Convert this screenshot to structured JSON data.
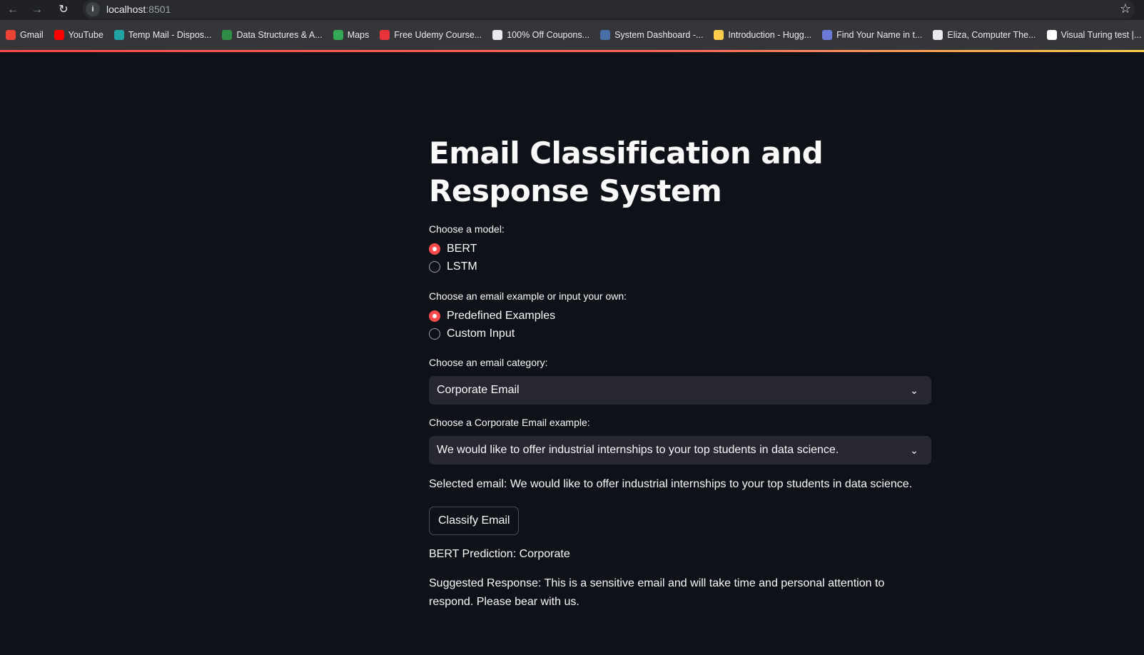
{
  "browser": {
    "url_host": "localhost",
    "url_port": ":8501",
    "bookmarks": [
      {
        "label": "Gmail",
        "icon": "gmail-icon",
        "color": "#ea4335"
      },
      {
        "label": "YouTube",
        "icon": "youtube-icon",
        "color": "#ff0000"
      },
      {
        "label": "Temp Mail - Dispos...",
        "icon": "temp-mail-icon",
        "color": "#20a4a4"
      },
      {
        "label": "Data Structures & A...",
        "icon": "gfg-icon",
        "color": "#2f8d46"
      },
      {
        "label": "Maps",
        "icon": "maps-icon",
        "color": "#34a853"
      },
      {
        "label": "Free Udemy Course...",
        "icon": "udemy-icon",
        "color": "#e8333a"
      },
      {
        "label": "100% Off Coupons...",
        "icon": "globe-icon",
        "color": "#e8eaed"
      },
      {
        "label": "System Dashboard -...",
        "icon": "dashboard-icon",
        "color": "#4a6fa5"
      },
      {
        "label": "Introduction - Hugg...",
        "icon": "huggingface-icon",
        "color": "#ffcc4d"
      },
      {
        "label": "Find Your Name in t...",
        "icon": "document-icon",
        "color": "#6b7bd6"
      },
      {
        "label": "Eliza, Computer The...",
        "icon": "globe-icon",
        "color": "#e8eaed"
      },
      {
        "label": "Visual Turing test |...",
        "icon": "ns-icon",
        "color": "#ffffff"
      }
    ]
  },
  "app": {
    "title": "Email Classification and Response System",
    "model_label": "Choose a model:",
    "model_options": [
      "BERT",
      "LSTM"
    ],
    "model_selected": "BERT",
    "source_label": "Choose an email example or input your own:",
    "source_options": [
      "Predefined Examples",
      "Custom Input"
    ],
    "source_selected": "Predefined Examples",
    "category_label": "Choose an email category:",
    "category_value": "Corporate Email",
    "example_label": "Choose a Corporate Email example:",
    "example_value": "We would like to offer industrial internships to your top students in data science.",
    "selected_email": "Selected email: We would like to offer industrial internships to your top students in data science.",
    "classify_button": "Classify Email",
    "prediction": "BERT Prediction: Corporate",
    "suggested_response": "Suggested Response: This is a sensitive email and will take time and personal attention to respond. Please bear with us."
  },
  "colors": {
    "background": "#0e1117",
    "accent": "#ff4b4b",
    "input_bg": "#262730"
  }
}
